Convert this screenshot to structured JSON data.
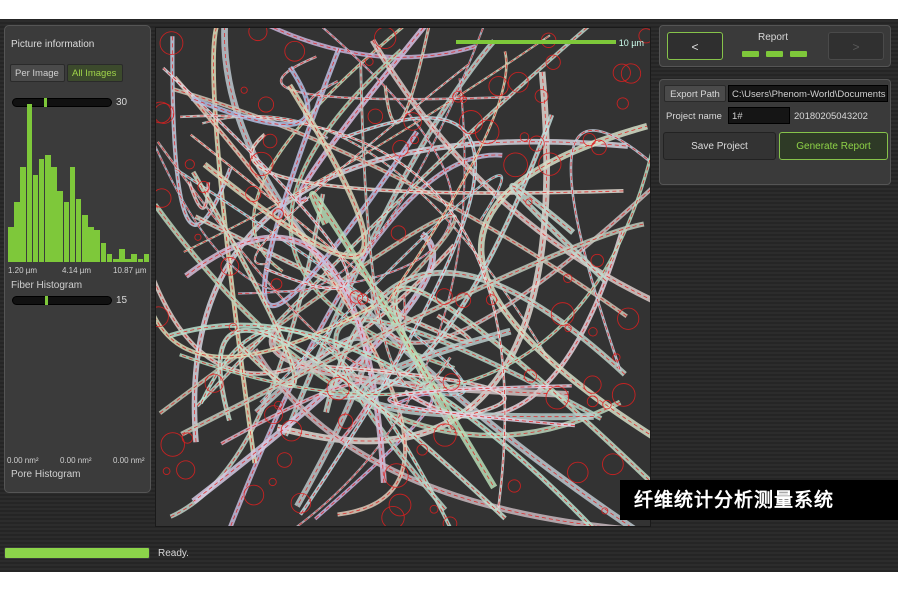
{
  "left_panel": {
    "title": "Picture information",
    "per_image_label": "Per Image",
    "all_images_label": "All Images",
    "fiber_slider_value": "30",
    "fiber_slider_level": 0.32,
    "fiber_hist_ticks": [
      "1.20 µm",
      "4.14 µm",
      "10.87 µm"
    ],
    "fiber_hist_label": "Fiber Histogram",
    "pore_slider_value": "15",
    "pore_slider_level": 0.33,
    "pore_hist_ticks": [
      "0.00 nm²",
      "0.00 nm²",
      "0.00 nm²"
    ],
    "pore_hist_label": "Pore Histogram"
  },
  "chart_data": {
    "type": "bar",
    "categories": [],
    "values": [
      22,
      38,
      60,
      100,
      55,
      65,
      68,
      60,
      45,
      38,
      60,
      40,
      30,
      22,
      20,
      12,
      5,
      2,
      8,
      2,
      5,
      2,
      5
    ],
    "xlabel": "",
    "ylabel": ""
  },
  "sem_image": {
    "scale_label": "10 µm"
  },
  "report_nav": {
    "title": "Report",
    "prev_label": "<",
    "next_label": ">",
    "dot_count": 3
  },
  "report": {
    "export_path_label": "Export Path",
    "export_path_value": "C:\\Users\\Phenom-World\\Documents",
    "project_name_label": "Project name",
    "project_name_value": "1#",
    "project_id": "20180205043202",
    "save_project_label": "Save Project",
    "generate_report_label": "Generate Report"
  },
  "status": {
    "text": "Ready.",
    "progress": 1.0
  },
  "caption": "纤维统计分析测量系统",
  "colors": {
    "accent_green": "#7ec83a",
    "fiber_overlay_red": "#e02020"
  }
}
